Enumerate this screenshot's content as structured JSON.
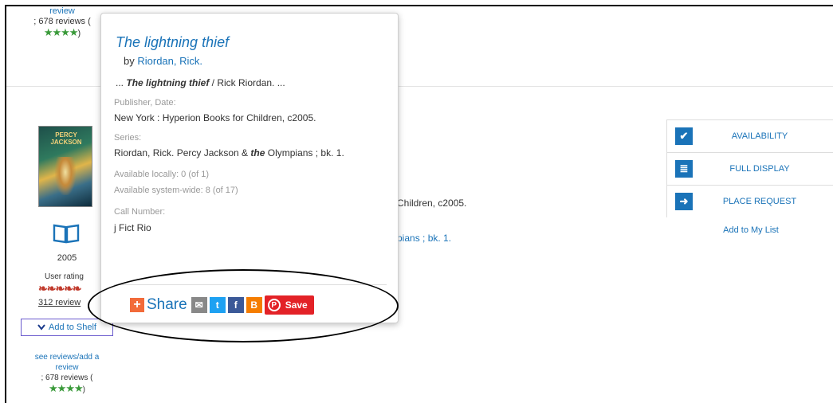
{
  "top_review": {
    "link_text": "review",
    "count": "; 678 reviews (",
    "stars": "★★★★",
    "close": ")"
  },
  "left": {
    "cover_title": "PERCY JACKSON",
    "year": "2005",
    "user_rating_label": "User rating",
    "user_rating_stars": "❧❧❧❧❧",
    "reviews_count": "312 review",
    "add_to_shelf": "Add to Shelf"
  },
  "bottom_review": {
    "link_text": "see reviews/add a review",
    "count": "; 678 reviews (",
    "stars": "★★★★",
    "close": ")"
  },
  "background": {
    "publisher_fragment": "Children, c2005.",
    "series_fragment": "pians ; bk. 1."
  },
  "popup": {
    "title": "The lightning thief",
    "author_prefix": "by",
    "author": "Riordan, Rick.",
    "excerpt_prefix": "...",
    "excerpt_title": "The lightning thief",
    "excerpt_rest": " / Rick Riordan. ...",
    "publisher_label": "Publisher, Date:",
    "publisher_value": "New York : Hyperion Books for Children, c2005.",
    "series_label": "Series:",
    "series_value_a": "Riordan, Rick. Percy Jackson & ",
    "series_value_the": "the",
    "series_value_b": " Olympians ; bk. 1.",
    "available_locally": "Available locally: 0 (of 1)",
    "available_system": "Available system-wide: 8 (of 17)",
    "call_number_label": "Call Number:",
    "call_number_value": "j Fict Rio",
    "share_label": "Share",
    "save_label": "Save"
  },
  "actions": {
    "availability": "AVAILABILITY",
    "full_display": "FULL DISPLAY",
    "place_request": "PLACE REQUEST",
    "add_to_my_list": "Add to My List"
  },
  "colors": {
    "link": "#1a73b8",
    "pinterest": "#e32227",
    "share_plus": "#f26b3a",
    "email": "#888888",
    "twitter": "#1da1f2",
    "facebook": "#3b5998",
    "blogger": "#f57d00"
  },
  "icons": {
    "availability": "check-icon",
    "full_display": "list-icon",
    "place_request": "sign-in-icon",
    "book": "open-book-icon"
  }
}
